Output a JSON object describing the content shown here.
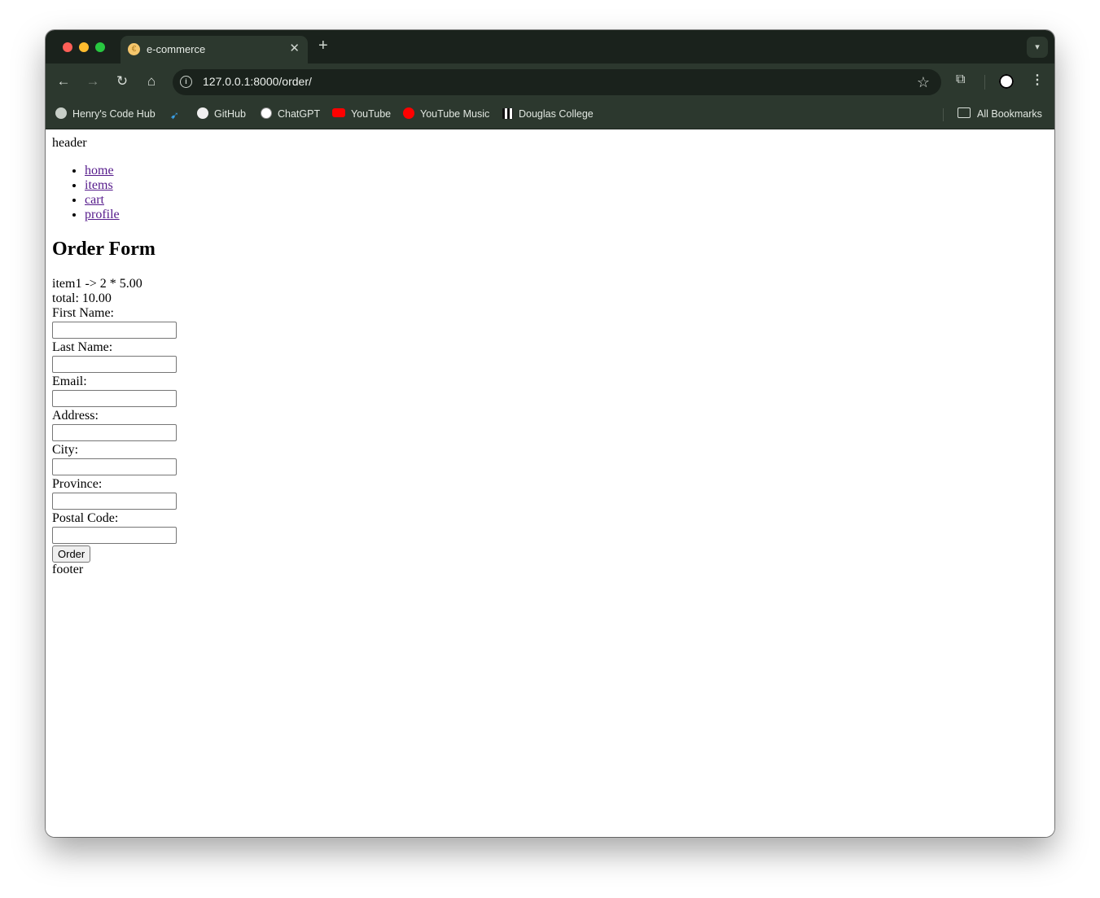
{
  "browser": {
    "tab": {
      "title": "e-commerce"
    },
    "new_tab_symbol": "+",
    "url": "127.0.0.1:8000/order/",
    "bookmarks": [
      {
        "label": "Henry's Code Hub",
        "icon": "globe-icon"
      },
      {
        "label": "",
        "icon": "bird-icon"
      },
      {
        "label": "GitHub",
        "icon": "github-icon"
      },
      {
        "label": "ChatGPT",
        "icon": "chatgpt-icon"
      },
      {
        "label": "YouTube",
        "icon": "youtube-icon"
      },
      {
        "label": "YouTube Music",
        "icon": "youtube-music-icon"
      },
      {
        "label": "Douglas College",
        "icon": "douglas-college-icon"
      }
    ],
    "all_bookmarks_label": "All Bookmarks"
  },
  "page": {
    "header": "header",
    "nav": [
      "home",
      "items",
      "cart",
      "profile"
    ],
    "title": "Order Form",
    "order_line": "item1 -> 2 * 5.00",
    "total_line": "total: 10.00",
    "fields": [
      {
        "label": "First Name:",
        "value": ""
      },
      {
        "label": "Last Name:",
        "value": ""
      },
      {
        "label": "Email:",
        "value": ""
      },
      {
        "label": "Address:",
        "value": ""
      },
      {
        "label": "City:",
        "value": ""
      },
      {
        "label": "Province:",
        "value": ""
      },
      {
        "label": "Postal Code:",
        "value": ""
      }
    ],
    "submit_label": "Order",
    "footer": "footer"
  },
  "colors": {
    "tab_strip": "#1a221c",
    "toolbar": "#2c382e",
    "visited_link": "#551a8b"
  }
}
